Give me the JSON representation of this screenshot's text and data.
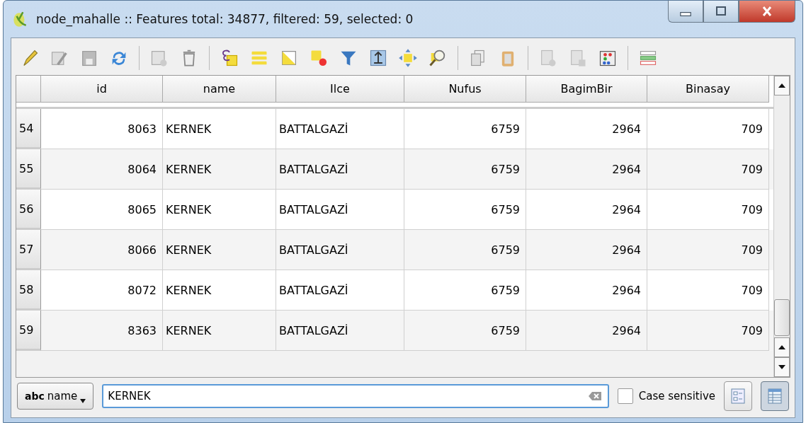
{
  "window": {
    "title": "node_mahalle :: Features total: 34877, filtered: 59, selected: 0"
  },
  "table": {
    "columns": [
      {
        "label": "id",
        "kind": "number"
      },
      {
        "label": "name",
        "kind": "text"
      },
      {
        "label": "Ilce",
        "kind": "text"
      },
      {
        "label": "Nufus",
        "kind": "number"
      },
      {
        "label": "BagimBir",
        "kind": "number"
      },
      {
        "label": "Binasay",
        "kind": "number"
      }
    ],
    "rows": [
      {
        "header": "54",
        "cells": [
          "8063",
          "KERNEK",
          "BATTALGAZİ",
          "6759",
          "2964",
          "709"
        ]
      },
      {
        "header": "55",
        "cells": [
          "8064",
          "KERNEK",
          "BATTALGAZİ",
          "6759",
          "2964",
          "709"
        ]
      },
      {
        "header": "56",
        "cells": [
          "8065",
          "KERNEK",
          "BATTALGAZİ",
          "6759",
          "2964",
          "709"
        ]
      },
      {
        "header": "57",
        "cells": [
          "8066",
          "KERNEK",
          "BATTALGAZİ",
          "6759",
          "2964",
          "709"
        ]
      },
      {
        "header": "58",
        "cells": [
          "8072",
          "KERNEK",
          "BATTALGAZİ",
          "6759",
          "2964",
          "709"
        ]
      },
      {
        "header": "59",
        "cells": [
          "8363",
          "KERNEK",
          "BATTALGAZİ",
          "6759",
          "2964",
          "709"
        ]
      }
    ]
  },
  "filter": {
    "column_button": {
      "prefix": "abc",
      "label": "name"
    },
    "value": "KERNEK",
    "case_sensitive": {
      "label": "Case sensitive",
      "checked": false
    }
  },
  "view_buttons": [
    {
      "selected": false
    },
    {
      "selected": true
    }
  ]
}
